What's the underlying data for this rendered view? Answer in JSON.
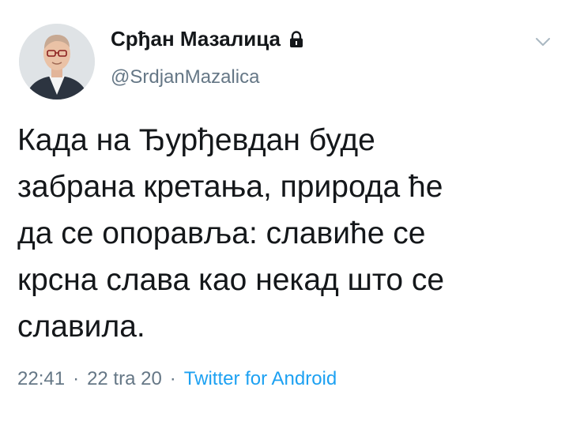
{
  "author": {
    "display_name": "Срђан Мазалица",
    "handle": "@SrdjanMazalica",
    "avatar_icon": "person-avatar",
    "protected_icon": "lock-icon"
  },
  "menu_icon": "chevron-down-icon",
  "tweet": {
    "lines": [
      "Када на Ђурђевдан буде",
      "забрана кретања, природа ће",
      "да се опоравља: славиће се",
      "крсна слава као некад што се",
      "славила."
    ]
  },
  "meta": {
    "time": "22:41",
    "date": "22 tra 20",
    "separator": "·",
    "source": "Twitter for Android"
  },
  "colors": {
    "text": "#14171a",
    "secondary": "#657786",
    "link": "#1da1f2"
  }
}
